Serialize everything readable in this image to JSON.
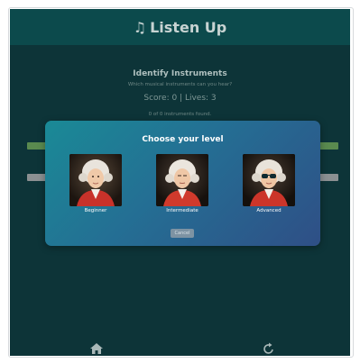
{
  "app": {
    "title": "Listen Up",
    "title_icon": "music-note-icon"
  },
  "game": {
    "title": "Identify Instruments",
    "subtitle": "Which musical instruments can you hear?",
    "score_text": "Score: 0 | Lives: 3",
    "found_text": "0 of 0 instruments found."
  },
  "modal": {
    "title": "Choose your level",
    "levels": [
      {
        "label": "Beginner"
      },
      {
        "label": "Intermediate"
      },
      {
        "label": "Advanced"
      }
    ],
    "cancel_label": "Cancel"
  },
  "nav": {
    "home_icon": "home-icon",
    "restart_icon": "restart-icon"
  },
  "colors": {
    "background": "#0d3438",
    "topbar": "#0c4a4c",
    "bar_green": "#5a8a4f",
    "bar_gray": "#8b9092",
    "modal_gradient_start": "#1a8a96",
    "modal_gradient_end": "#2f4f86"
  }
}
